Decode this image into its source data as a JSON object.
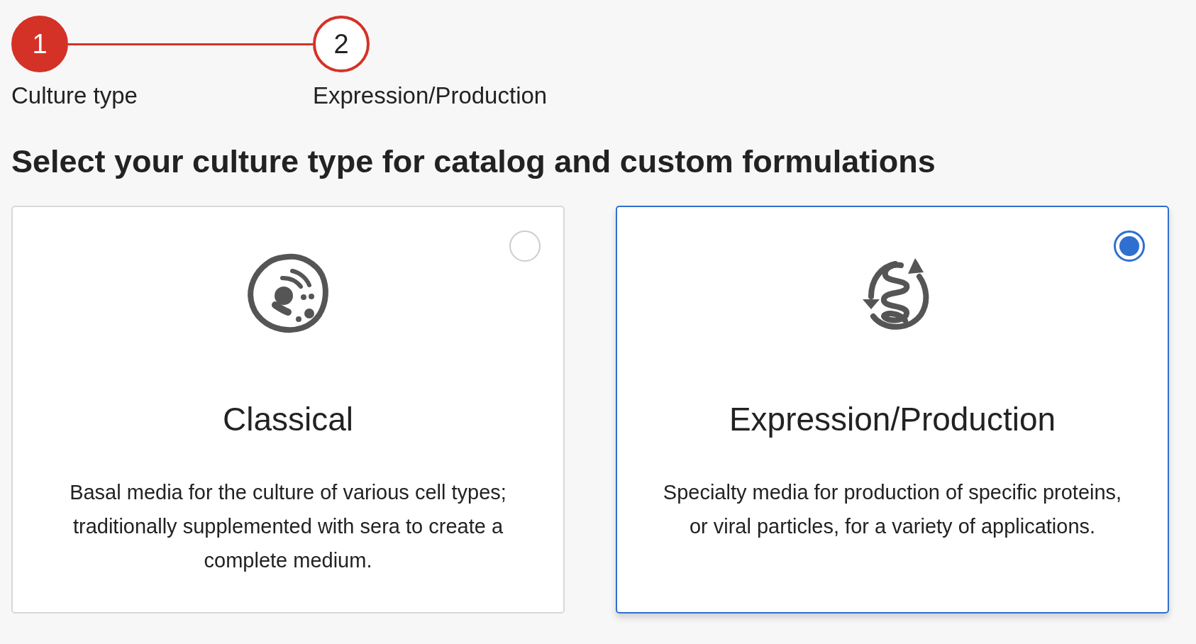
{
  "stepper": {
    "steps": [
      {
        "number": "1",
        "label": "Culture type",
        "active": true
      },
      {
        "number": "2",
        "label": "Expression/Production",
        "active": false
      }
    ]
  },
  "heading": "Select your culture type for catalog and custom formulations",
  "options": [
    {
      "kind": "cell",
      "title": "Classical",
      "description": "Basal media for the culture of various cell types; traditionally supplemented with sera to create a complete medium.",
      "selected": false
    },
    {
      "kind": "spiral",
      "title": "Expression/Production",
      "description": "Specialty media for production of specific proteins, or viral particles, for a variety of applications.",
      "selected": true
    }
  ]
}
